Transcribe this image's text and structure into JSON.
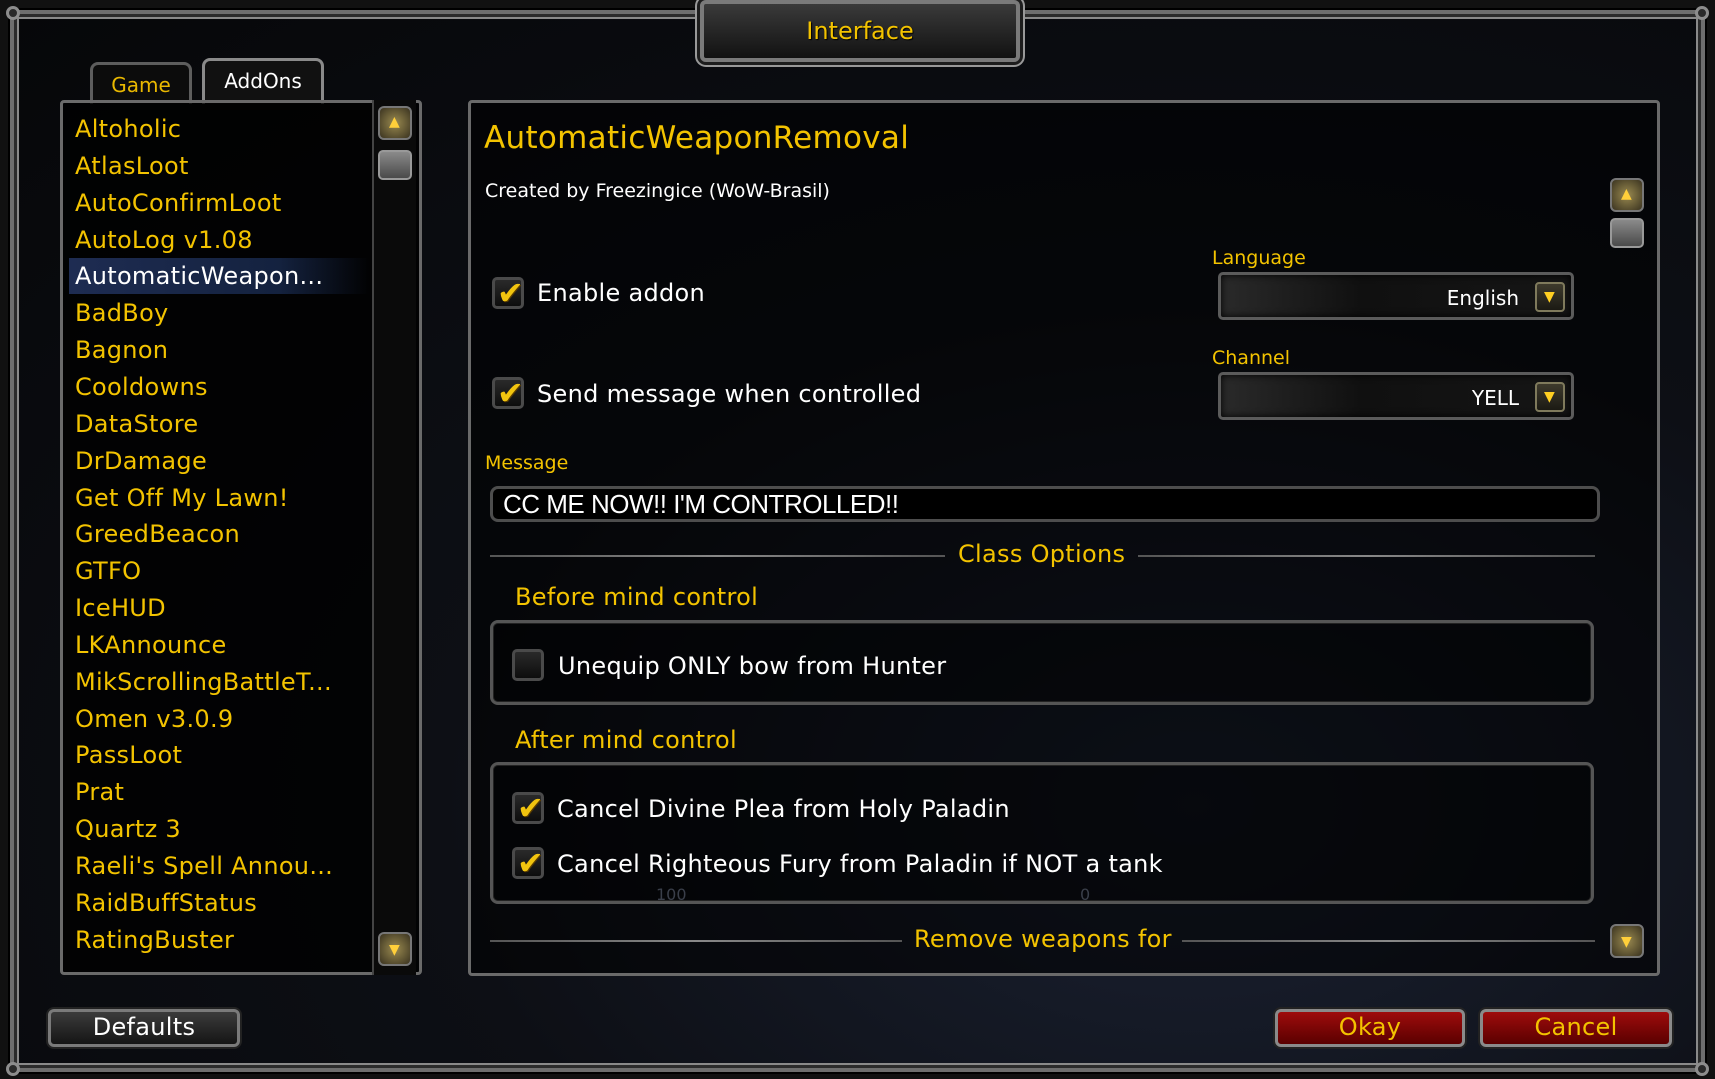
{
  "window": {
    "title": "Interface"
  },
  "tabs": [
    {
      "label": "Game",
      "active": false
    },
    {
      "label": "AddOns",
      "active": true
    }
  ],
  "addon_list": [
    {
      "label": "Altoholic",
      "expandable": true
    },
    {
      "label": "AtlasLoot",
      "expandable": true
    },
    {
      "label": "AutoConfirmLoot",
      "expandable": false
    },
    {
      "label": "AutoLog v1.08",
      "expandable": false
    },
    {
      "label": "AutomaticWeapon...",
      "expandable": false,
      "selected": true
    },
    {
      "label": "BadBoy",
      "expandable": false
    },
    {
      "label": "Bagnon",
      "expandable": true
    },
    {
      "label": "Cooldowns",
      "expandable": false
    },
    {
      "label": "DataStore",
      "expandable": true
    },
    {
      "label": "DrDamage",
      "expandable": true
    },
    {
      "label": "Get Off My Lawn!",
      "expandable": false
    },
    {
      "label": "GreedBeacon",
      "expandable": true
    },
    {
      "label": "GTFO",
      "expandable": false
    },
    {
      "label": "IceHUD",
      "expandable": false
    },
    {
      "label": "LKAnnounce",
      "expandable": true
    },
    {
      "label": "MikScrollingBattleT...",
      "expandable": false
    },
    {
      "label": "Omen v3.0.9",
      "expandable": true
    },
    {
      "label": "PassLoot",
      "expandable": true
    },
    {
      "label": "Prat",
      "expandable": true
    },
    {
      "label": "Quartz 3",
      "expandable": true
    },
    {
      "label": "Raeli's Spell Annou...",
      "expandable": true
    },
    {
      "label": "RaidBuffStatus",
      "expandable": false
    },
    {
      "label": "RatingBuster",
      "expandable": true
    }
  ],
  "addon": {
    "title": "AutomaticWeaponRemoval",
    "author": "Created by Freezingice (WoW-Brasil)",
    "enable_label": "Enable addon",
    "enable_checked": true,
    "send_label": "Send message when controlled",
    "send_checked": true,
    "language_label": "Language",
    "language_value": "English",
    "channel_label": "Channel",
    "channel_value": "YELL",
    "message_label": "Message",
    "message_value": "CC ME NOW!! I'M CONTROLLED!!",
    "class_options_label": "Class Options",
    "before_label": "Before mind control",
    "hunter_label": "Unequip ONLY bow from Hunter",
    "hunter_checked": false,
    "after_label": "After mind control",
    "plea_label": "Cancel Divine Plea from Holy Paladin",
    "plea_checked": true,
    "fury_label": "Cancel Righteous Fury from Paladin if NOT a tank",
    "fury_checked": true,
    "remove_label": "Remove weapons for"
  },
  "background_numbers": {
    "left": "100",
    "right": "0"
  },
  "buttons": {
    "defaults": "Defaults",
    "okay": "Okay",
    "cancel": "Cancel"
  },
  "icons": {
    "expand": "plus-icon",
    "check": "check-icon",
    "dropdown": "chevron-down-icon",
    "scroll_up": "scroll-up-icon",
    "scroll_down": "scroll-down-icon"
  },
  "colors": {
    "gold": "#f3c300",
    "white": "#ffffff",
    "button_red": "#9e0c0c"
  }
}
